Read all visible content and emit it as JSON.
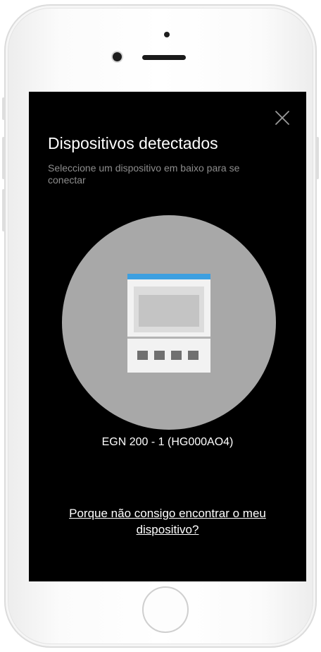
{
  "modal": {
    "title": "Dispositivos detectados",
    "subtitle": "Seleccione um dispositivo em baixo para se conectar",
    "close_icon": "close-icon"
  },
  "device": {
    "name": "EGN 200 - 1 (HG000AO4)",
    "icon": "control-panel-device-icon"
  },
  "help_link": "Porque não consigo encontrar o meu dispositivo?",
  "colors": {
    "screen_background": "#000000",
    "device_circle": "#a8a8a8",
    "device_header_accent": "#3d9fe0",
    "subtitle_text": "#8d8d8d"
  }
}
